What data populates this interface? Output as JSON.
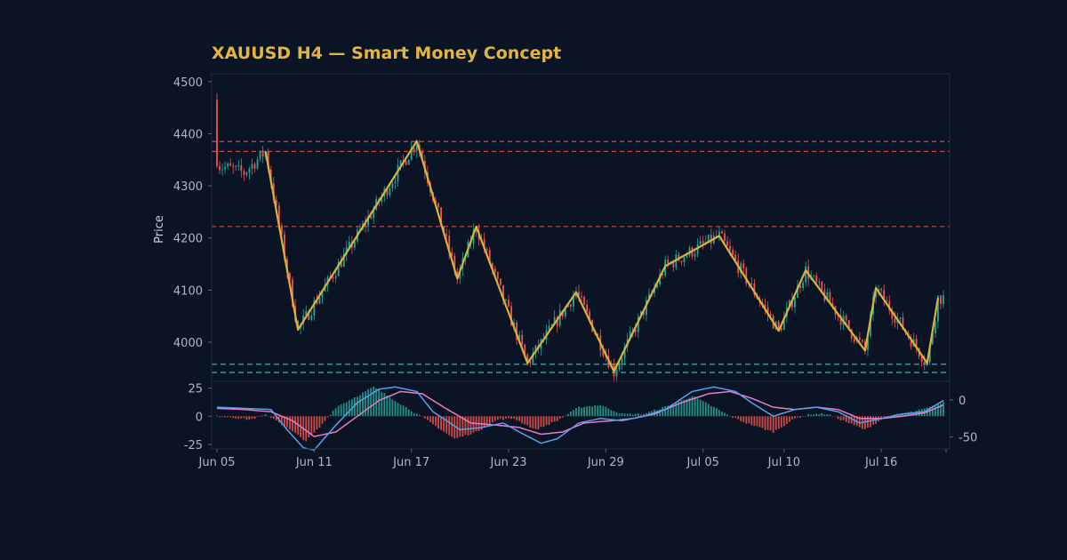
{
  "chart_data": {
    "type": "candlestick",
    "title": "XAUUSD H4 — Smart Money Concept",
    "ylabel": "Price",
    "xlabel": "",
    "grid": false,
    "colors": {
      "background": "#0b1424",
      "panel_border": "#1e2a3d",
      "up": "#26a69a",
      "down": "#ef5350",
      "zigzag": "#d9b43a",
      "macd": "#5aa0e8",
      "signal": "#e87bc4",
      "title": "#e3b53f",
      "text": "#aeb7c6"
    },
    "price_panel": {
      "ylim": [
        3925,
        4515
      ],
      "yticks": [
        4000,
        4100,
        4200,
        4300,
        4400,
        4500
      ],
      "resistance_levels": [
        4385,
        4366,
        4222
      ],
      "support_levels": [
        3958,
        3942
      ]
    },
    "x_axis": {
      "total_bars": 270,
      "ticks": [
        {
          "bar": 0,
          "label": "Jun 05"
        },
        {
          "bar": 36,
          "label": "Jun 11"
        },
        {
          "bar": 72,
          "label": "Jun 17"
        },
        {
          "bar": 108,
          "label": "Jun 23"
        },
        {
          "bar": 144,
          "label": "Jun 29"
        },
        {
          "bar": 180,
          "label": "Jul 05"
        },
        {
          "bar": 210,
          "label": "Jul 10"
        },
        {
          "bar": 246,
          "label": "Jul 16"
        }
      ]
    },
    "zigzag": [
      {
        "bar": 18,
        "price": 4366
      },
      {
        "bar": 30,
        "price": 4024
      },
      {
        "bar": 74,
        "price": 4386
      },
      {
        "bar": 89,
        "price": 4122
      },
      {
        "bar": 96,
        "price": 4222
      },
      {
        "bar": 115,
        "price": 3960
      },
      {
        "bar": 133,
        "price": 4096
      },
      {
        "bar": 147,
        "price": 3944
      },
      {
        "bar": 166,
        "price": 4146
      },
      {
        "bar": 186,
        "price": 4204
      },
      {
        "bar": 208,
        "price": 4022
      },
      {
        "bar": 218,
        "price": 4138
      },
      {
        "bar": 240,
        "price": 3984
      },
      {
        "bar": 244,
        "price": 4104
      },
      {
        "bar": 263,
        "price": 3960
      },
      {
        "bar": 267,
        "price": 4085
      }
    ],
    "indicator_panel": {
      "left_ylim": [
        -29,
        31
      ],
      "left_yticks": [
        25,
        0,
        -25
      ],
      "right_ylim": [
        -66,
        25
      ],
      "right_yticks": [
        0,
        -50
      ],
      "histogram_profile": [
        {
          "bar": 0,
          "value": 0
        },
        {
          "bar": 6,
          "value": -1
        },
        {
          "bar": 12,
          "value": -3
        },
        {
          "bar": 18,
          "value": 1
        },
        {
          "bar": 21,
          "value": -2
        },
        {
          "bar": 27,
          "value": -12
        },
        {
          "bar": 33,
          "value": -22
        },
        {
          "bar": 38,
          "value": -10
        },
        {
          "bar": 44,
          "value": 8
        },
        {
          "bar": 52,
          "value": 18
        },
        {
          "bar": 58,
          "value": 26
        },
        {
          "bar": 66,
          "value": 14
        },
        {
          "bar": 74,
          "value": 2
        },
        {
          "bar": 78,
          "value": -4
        },
        {
          "bar": 88,
          "value": -20
        },
        {
          "bar": 96,
          "value": -14
        },
        {
          "bar": 104,
          "value": -3
        },
        {
          "bar": 110,
          "value": -2
        },
        {
          "bar": 118,
          "value": -12
        },
        {
          "bar": 126,
          "value": -4
        },
        {
          "bar": 134,
          "value": 8
        },
        {
          "bar": 142,
          "value": 10
        },
        {
          "bar": 150,
          "value": 2
        },
        {
          "bar": 158,
          "value": 2
        },
        {
          "bar": 168,
          "value": 10
        },
        {
          "bar": 176,
          "value": 18
        },
        {
          "bar": 184,
          "value": 8
        },
        {
          "bar": 190,
          "value": 0
        },
        {
          "bar": 196,
          "value": -6
        },
        {
          "bar": 206,
          "value": -14
        },
        {
          "bar": 214,
          "value": -2
        },
        {
          "bar": 220,
          "value": 2
        },
        {
          "bar": 226,
          "value": 2
        },
        {
          "bar": 232,
          "value": -4
        },
        {
          "bar": 240,
          "value": -12
        },
        {
          "bar": 246,
          "value": -3
        },
        {
          "bar": 252,
          "value": 2
        },
        {
          "bar": 258,
          "value": 4
        },
        {
          "bar": 264,
          "value": 8
        },
        {
          "bar": 269,
          "value": 12
        }
      ],
      "macd_profile": [
        {
          "bar": 0,
          "value": 8
        },
        {
          "bar": 10,
          "value": 7
        },
        {
          "bar": 20,
          "value": 6
        },
        {
          "bar": 26,
          "value": -12
        },
        {
          "bar": 32,
          "value": -28
        },
        {
          "bar": 36,
          "value": -30
        },
        {
          "bar": 44,
          "value": -8
        },
        {
          "bar": 52,
          "value": 12
        },
        {
          "bar": 60,
          "value": 24
        },
        {
          "bar": 66,
          "value": 26
        },
        {
          "bar": 74,
          "value": 22
        },
        {
          "bar": 80,
          "value": 4
        },
        {
          "bar": 90,
          "value": -12
        },
        {
          "bar": 98,
          "value": -10
        },
        {
          "bar": 106,
          "value": -6
        },
        {
          "bar": 112,
          "value": -14
        },
        {
          "bar": 120,
          "value": -24
        },
        {
          "bar": 126,
          "value": -20
        },
        {
          "bar": 134,
          "value": -6
        },
        {
          "bar": 142,
          "value": -2
        },
        {
          "bar": 150,
          "value": -4
        },
        {
          "bar": 158,
          "value": 0
        },
        {
          "bar": 166,
          "value": 6
        },
        {
          "bar": 176,
          "value": 22
        },
        {
          "bar": 184,
          "value": 26
        },
        {
          "bar": 192,
          "value": 22
        },
        {
          "bar": 198,
          "value": 12
        },
        {
          "bar": 206,
          "value": 0
        },
        {
          "bar": 214,
          "value": 6
        },
        {
          "bar": 222,
          "value": 8
        },
        {
          "bar": 230,
          "value": 4
        },
        {
          "bar": 238,
          "value": -6
        },
        {
          "bar": 246,
          "value": -2
        },
        {
          "bar": 254,
          "value": 2
        },
        {
          "bar": 262,
          "value": 4
        },
        {
          "bar": 269,
          "value": 14
        }
      ],
      "signal_profile": [
        {
          "bar": 0,
          "value": 7
        },
        {
          "bar": 10,
          "value": 6
        },
        {
          "bar": 20,
          "value": 4
        },
        {
          "bar": 28,
          "value": -4
        },
        {
          "bar": 36,
          "value": -18
        },
        {
          "bar": 44,
          "value": -14
        },
        {
          "bar": 52,
          "value": 0
        },
        {
          "bar": 60,
          "value": 14
        },
        {
          "bar": 68,
          "value": 22
        },
        {
          "bar": 76,
          "value": 20
        },
        {
          "bar": 84,
          "value": 8
        },
        {
          "bar": 94,
          "value": -6
        },
        {
          "bar": 104,
          "value": -8
        },
        {
          "bar": 112,
          "value": -10
        },
        {
          "bar": 120,
          "value": -16
        },
        {
          "bar": 128,
          "value": -14
        },
        {
          "bar": 136,
          "value": -6
        },
        {
          "bar": 146,
          "value": -4
        },
        {
          "bar": 154,
          "value": -2
        },
        {
          "bar": 162,
          "value": 2
        },
        {
          "bar": 172,
          "value": 12
        },
        {
          "bar": 182,
          "value": 20
        },
        {
          "bar": 190,
          "value": 22
        },
        {
          "bar": 198,
          "value": 16
        },
        {
          "bar": 206,
          "value": 8
        },
        {
          "bar": 214,
          "value": 6
        },
        {
          "bar": 222,
          "value": 8
        },
        {
          "bar": 230,
          "value": 6
        },
        {
          "bar": 238,
          "value": -2
        },
        {
          "bar": 246,
          "value": -2
        },
        {
          "bar": 254,
          "value": 0
        },
        {
          "bar": 262,
          "value": 3
        },
        {
          "bar": 269,
          "value": 10
        }
      ]
    }
  }
}
